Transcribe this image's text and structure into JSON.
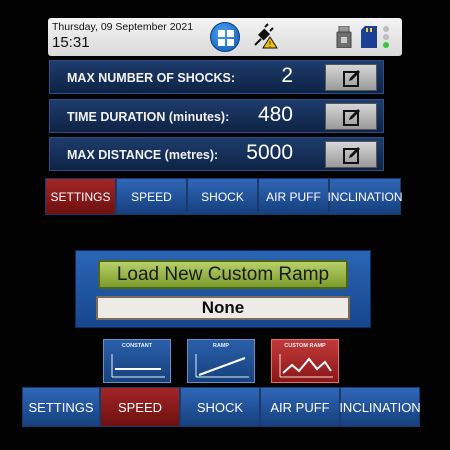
{
  "status_bar": {
    "date": "Thursday, 09 September 2021",
    "time": "15:31",
    "icons": [
      "windows-start-icon",
      "power-plug-warning-icon",
      "usb-drive-icon",
      "sd-card-icon"
    ]
  },
  "settings_rows": [
    {
      "label": "MAX NUMBER OF SHOCKS:",
      "value": "2"
    },
    {
      "label": "TIME DURATION (minutes):",
      "value": "480"
    },
    {
      "label": "MAX DISTANCE (metres):",
      "value": "5000"
    }
  ],
  "top_tabs": [
    {
      "label": "SETTINGS",
      "active": true
    },
    {
      "label": "SPEED",
      "active": false
    },
    {
      "label": "SHOCK",
      "active": false
    },
    {
      "label": "AIR PUFF",
      "active": false
    },
    {
      "label": "INCLINATION",
      "active": false
    }
  ],
  "ramp": {
    "load_button": "Load New Custom Ramp",
    "current": "None"
  },
  "ramp_types": [
    {
      "label": "CONSTANT",
      "selected": false
    },
    {
      "label": "RAMP",
      "selected": false
    },
    {
      "label": "CUSTOM RAMP",
      "selected": true
    }
  ],
  "bottom_tabs": [
    {
      "label": "SETTINGS",
      "active": false
    },
    {
      "label": "SPEED",
      "active": true
    },
    {
      "label": "SHOCK",
      "active": false
    },
    {
      "label": "AIR PUFF",
      "active": false
    },
    {
      "label": "INCLINATION",
      "active": false
    }
  ],
  "colors": {
    "tab_blue": "#2f67b8",
    "tab_active_red": "#a32626",
    "load_button_green": "#9cb84a",
    "status_dot_green": "#3cc43c"
  }
}
